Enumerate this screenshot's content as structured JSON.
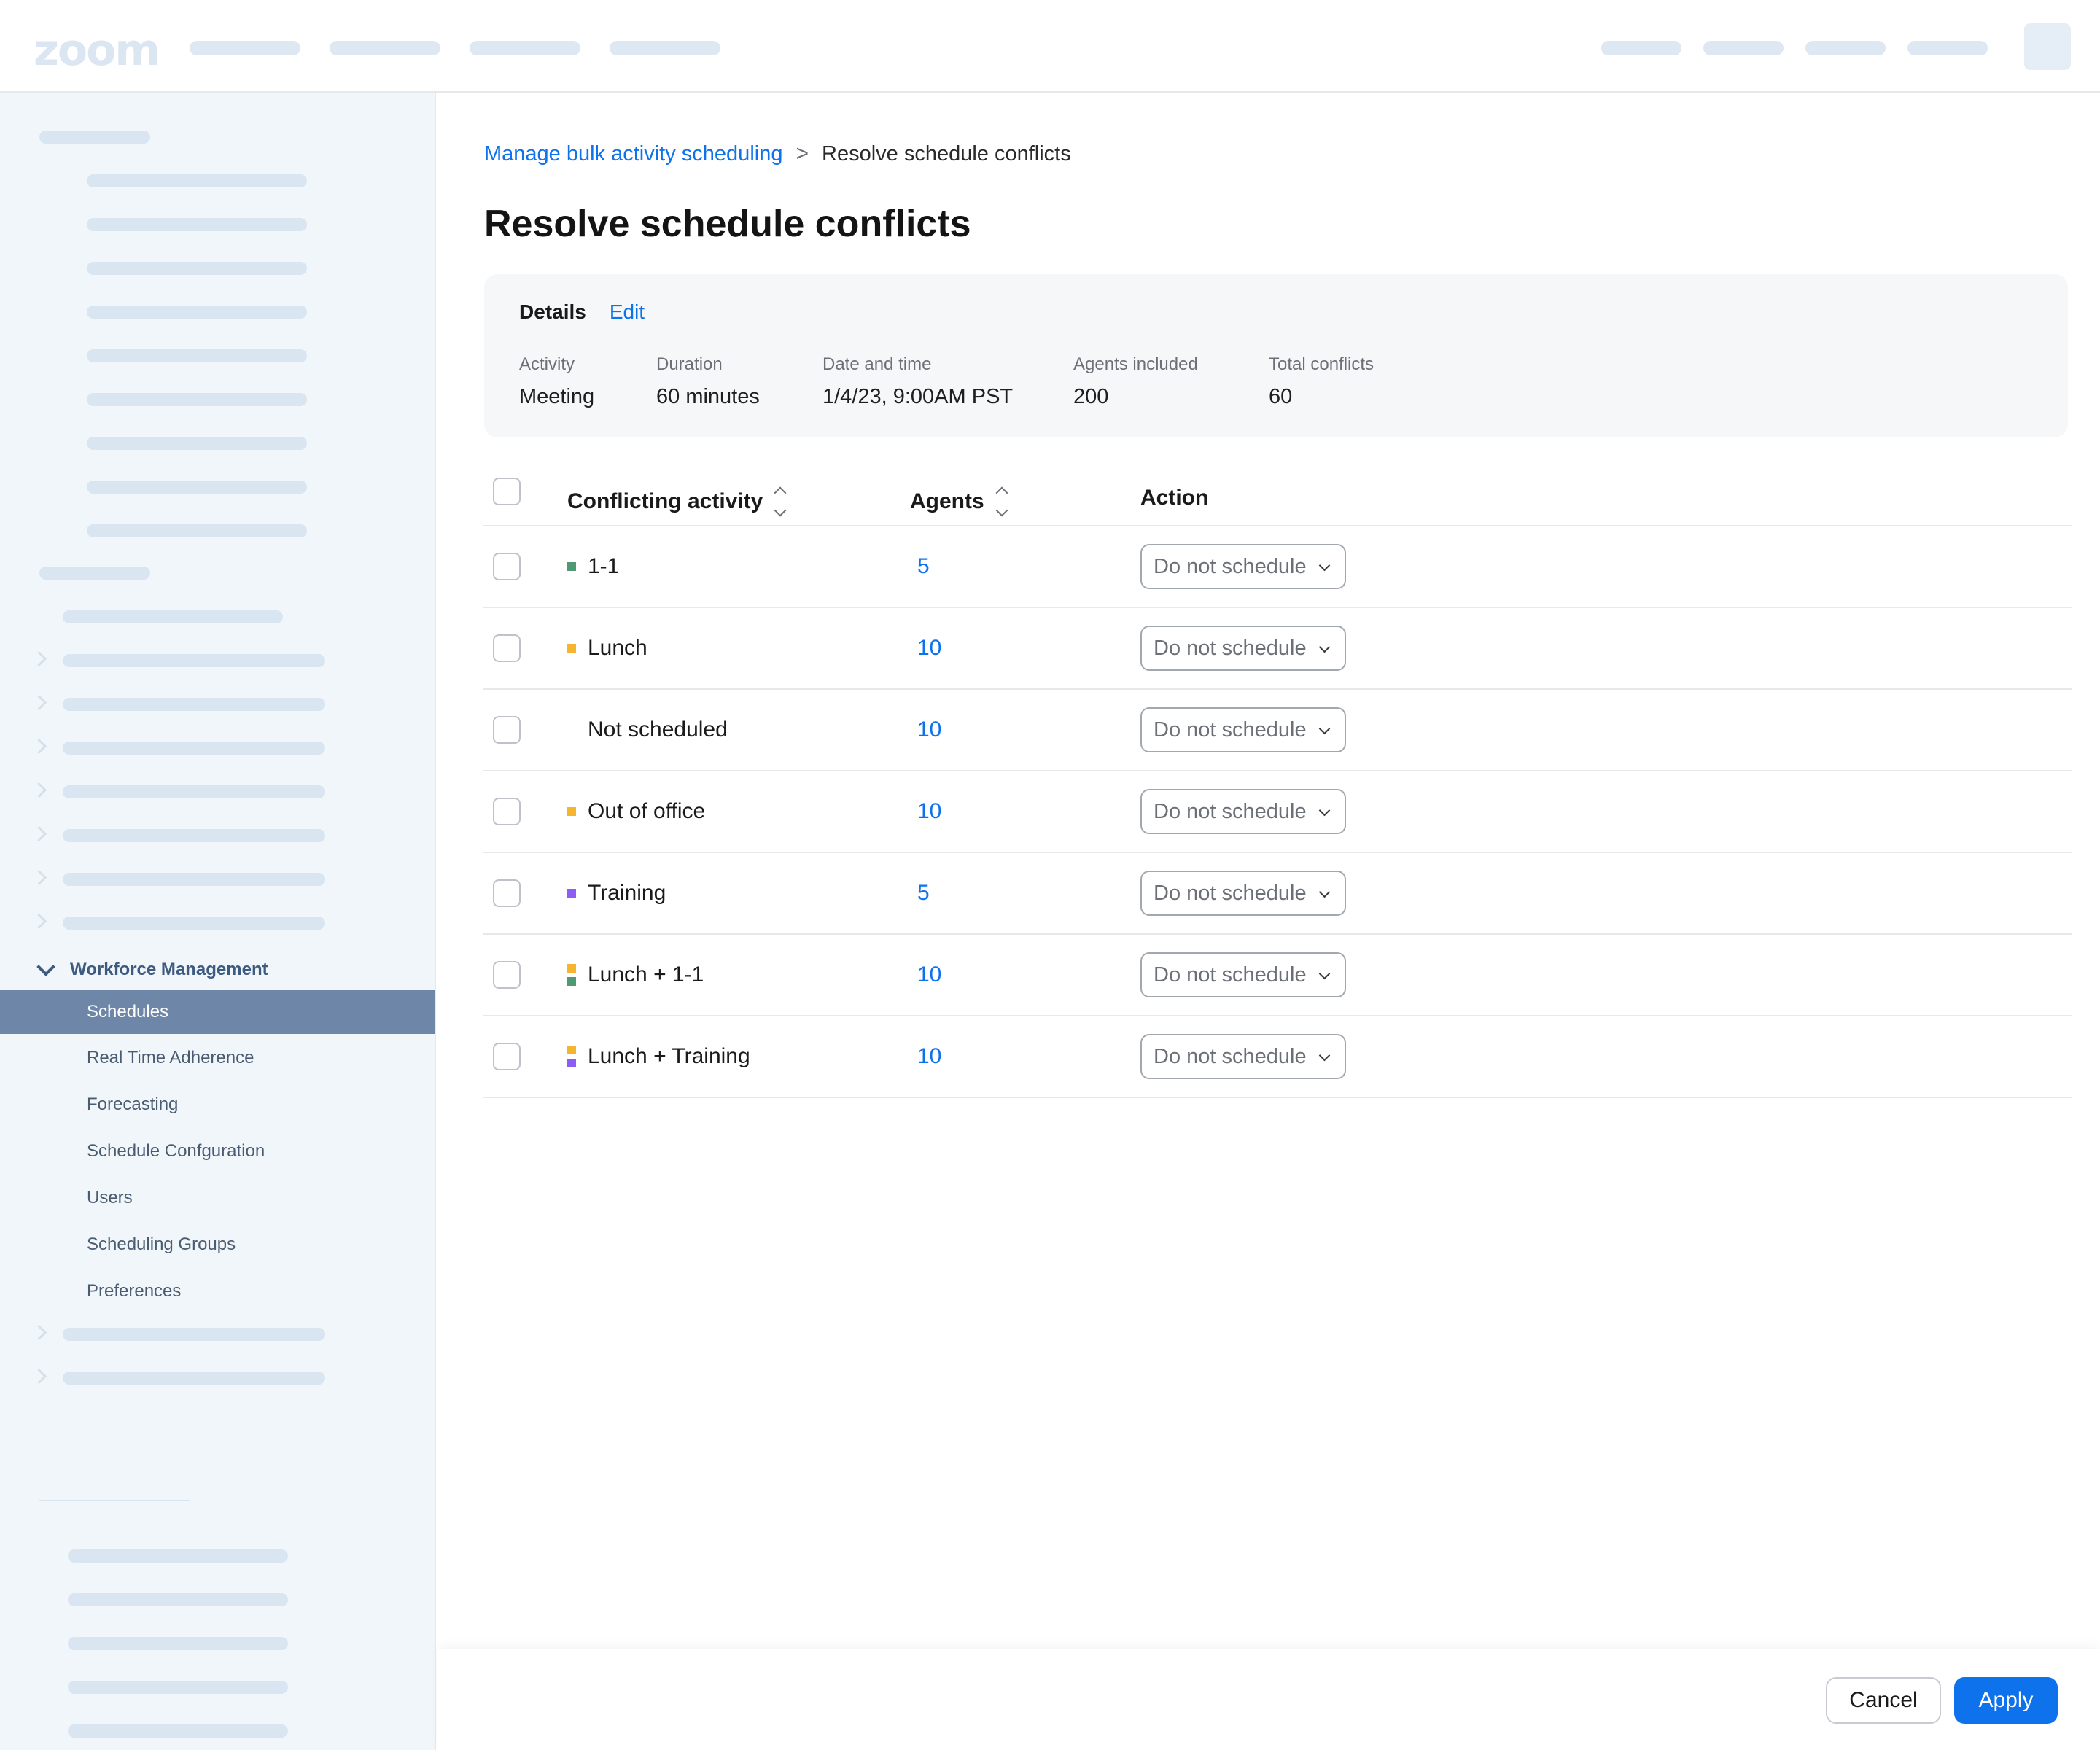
{
  "app": {
    "logo": "zoom"
  },
  "breadcrumb": {
    "parent": "Manage bulk activity scheduling",
    "separator": ">",
    "current": "Resolve schedule conflicts"
  },
  "page_title": "Resolve schedule conflicts",
  "details": {
    "title": "Details",
    "edit_label": "Edit",
    "fields": [
      {
        "label": "Activity",
        "value": "Meeting"
      },
      {
        "label": "Duration",
        "value": "60 minutes"
      },
      {
        "label": "Date and time",
        "value": "1/4/23, 9:00AM PST"
      },
      {
        "label": "Agents included",
        "value": "200"
      },
      {
        "label": "Total conflicts",
        "value": "60"
      }
    ]
  },
  "table": {
    "headers": {
      "activity": "Conflicting activity",
      "agents": "Agents",
      "action": "Action"
    },
    "rows": [
      {
        "activity": "1-1",
        "agents": "5",
        "action": "Do not schedule",
        "swatches": [
          "#4f9a74"
        ]
      },
      {
        "activity": "Lunch",
        "agents": "10",
        "action": "Do not schedule",
        "swatches": [
          "#f5b52e"
        ]
      },
      {
        "activity": "Not scheduled",
        "agents": "10",
        "action": "Do not schedule",
        "swatches": []
      },
      {
        "activity": "Out of office",
        "agents": "10",
        "action": "Do not schedule",
        "swatches": [
          "#f5b52e"
        ]
      },
      {
        "activity": "Training",
        "agents": "5",
        "action": "Do not schedule",
        "swatches": [
          "#8b5cf6"
        ]
      },
      {
        "activity": "Lunch + 1-1",
        "agents": "10",
        "action": "Do not schedule",
        "swatches": [
          "#f5b52e",
          "#4f9a74"
        ]
      },
      {
        "activity": "Lunch + Training",
        "agents": "10",
        "action": "Do not schedule",
        "swatches": [
          "#f5b52e",
          "#8b5cf6"
        ]
      }
    ]
  },
  "sidebar": {
    "section_title": "Workforce Management",
    "items": [
      {
        "label": "Schedules",
        "active": true
      },
      {
        "label": "Real Time Adherence",
        "active": false
      },
      {
        "label": "Forecasting",
        "active": false
      },
      {
        "label": "Schedule Confguration",
        "active": false
      },
      {
        "label": "Users",
        "active": false
      },
      {
        "label": "Scheduling Groups",
        "active": false
      },
      {
        "label": "Preferences",
        "active": false
      }
    ]
  },
  "footer": {
    "cancel_label": "Cancel",
    "apply_label": "Apply"
  },
  "colors": {
    "accent": "#0e72ed",
    "sidebar_active": "#6e87a9",
    "sidebar_bg": "#f1f6fa"
  },
  "icons": [
    "chevron-right-icon",
    "sort-icon",
    "chevron-down-icon"
  ]
}
